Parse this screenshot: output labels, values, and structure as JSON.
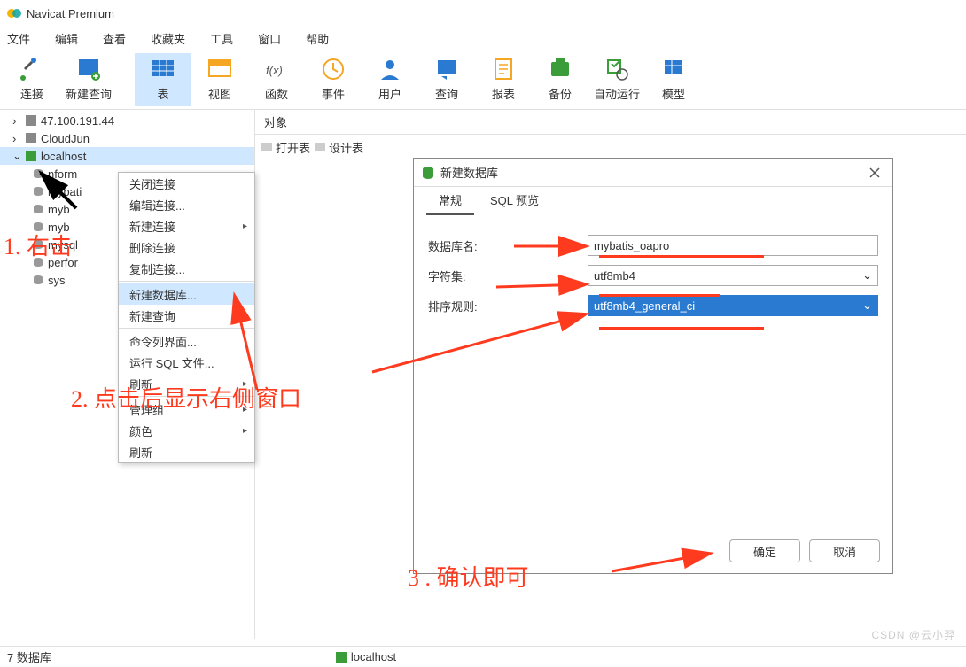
{
  "app": {
    "title": "Navicat Premium"
  },
  "menu": [
    "文件",
    "编辑",
    "查看",
    "收藏夹",
    "工具",
    "窗口",
    "帮助"
  ],
  "toolbar": [
    {
      "label": "连接",
      "icon": "plug"
    },
    {
      "label": "新建查询",
      "icon": "newq"
    },
    {
      "label": "表",
      "icon": "table",
      "sel": true
    },
    {
      "label": "视图",
      "icon": "view"
    },
    {
      "label": "函数",
      "icon": "fx"
    },
    {
      "label": "事件",
      "icon": "event"
    },
    {
      "label": "用户",
      "icon": "user"
    },
    {
      "label": "查询",
      "icon": "query"
    },
    {
      "label": "报表",
      "icon": "report"
    },
    {
      "label": "备份",
      "icon": "backup"
    },
    {
      "label": "自动运行",
      "icon": "auto"
    },
    {
      "label": "模型",
      "icon": "model"
    }
  ],
  "tree": [
    {
      "label": "47.100.191.44",
      "icon": "conn-off"
    },
    {
      "label": "CloudJun",
      "icon": "conn-off"
    },
    {
      "label": "localhost",
      "icon": "conn-on",
      "sel": true,
      "exp": true
    },
    {
      "label": "nform",
      "icon": "db",
      "sub": true
    },
    {
      "label": "mybati",
      "icon": "db",
      "sub": true
    },
    {
      "label": "myb",
      "icon": "db",
      "sub": true
    },
    {
      "label": "myb",
      "icon": "db",
      "sub": true
    },
    {
      "label": "mysql",
      "icon": "db",
      "sub": true
    },
    {
      "label": "perfor",
      "icon": "db",
      "sub": true
    },
    {
      "label": "sys",
      "icon": "db",
      "sub": true
    }
  ],
  "object_tab": "对象",
  "sub_toolbar": {
    "open": "打开表",
    "design": "设计表"
  },
  "context_menu": [
    {
      "t": "关闭连接"
    },
    {
      "t": "编辑连接..."
    },
    {
      "t": "新建连接",
      "arr": true
    },
    {
      "t": "删除连接"
    },
    {
      "t": "复制连接..."
    },
    {
      "sep": true
    },
    {
      "t": "新建数据库...",
      "sel": true
    },
    {
      "t": "新建查询"
    },
    {
      "sep": true
    },
    {
      "t": "命令列界面..."
    },
    {
      "t": "运行 SQL 文件..."
    },
    {
      "t": "刷新",
      "arr": true
    },
    {
      "sep": true
    },
    {
      "t": "管理组",
      "arr": true
    },
    {
      "t": "颜色",
      "arr": true
    },
    {
      "t": "刷新"
    }
  ],
  "dialog": {
    "title": "新建数据库",
    "tabs": [
      "常规",
      "SQL 预览"
    ],
    "fields": {
      "dbname_label": "数据库名:",
      "dbname_value": "mybatis_oapro",
      "charset_label": "字符集:",
      "charset_value": "utf8mb4",
      "collation_label": "排序规则:",
      "collation_value": "utf8mb4_general_ci"
    },
    "ok": "确定",
    "cancel": "取消"
  },
  "annotations": {
    "a1": "1. 右击",
    "a2": "2. 点击后显示右侧窗口",
    "a3": "3 . 确认即可"
  },
  "status": {
    "left": "7 数据库",
    "conn": "localhost"
  },
  "watermark": "CSDN @云小羿"
}
